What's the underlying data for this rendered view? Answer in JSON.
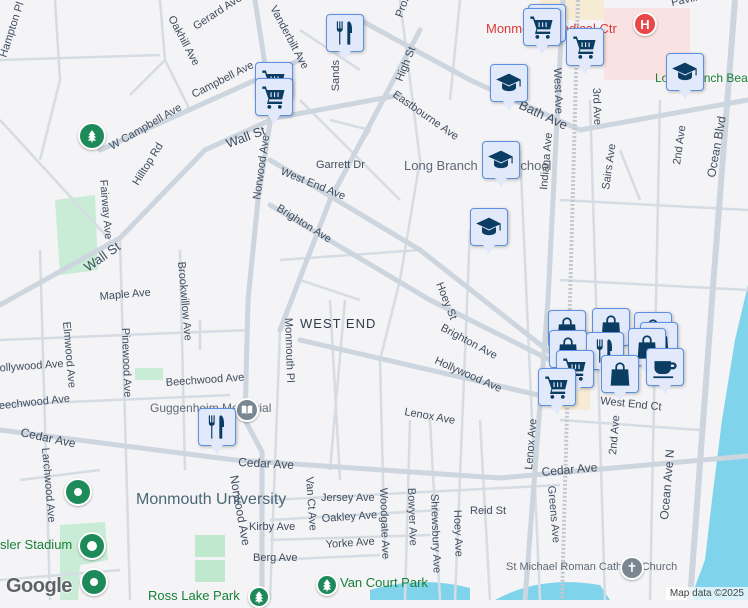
{
  "area_label": "WEST END",
  "streets": [
    "Gerard Ave",
    "Oakhill Ave",
    "Vanderbilt Ave",
    "Campbell Ave",
    "W Campbell Ave",
    "Hilltop Rd",
    "Wall St",
    "Wall St",
    "Sands",
    "High St",
    "Prospect",
    "Eastbourne Ave",
    "Bath Ave",
    "Garrett Dr",
    "West End Ave",
    "Brighton Ave",
    "Norwood Ave",
    "Fairway Ave",
    "Maple Ave",
    "Brookwillow Ave",
    "Elmwood Ave",
    "Pinewood Ave",
    "Monmouth Pl",
    "Hollywood Ave",
    "Beechwood Ave",
    "Beechwood Ave",
    "Hoey St",
    "Brighton Ave",
    "Hollywood Ave",
    "Lenox Ave",
    "Cedar Ave",
    "Cedar Ave",
    "Cedar Ave",
    "Larchwood Ave",
    "Norwood Ave",
    "Van Ct Ave",
    "Jersey Ave",
    "Oakley Ave",
    "Kirby Ave",
    "Yorke Ave",
    "Berg Ave",
    "Woodgate Ave",
    "Bowyer Ave",
    "Shrewsbury Ave",
    "Hoey Ave",
    "Reid St",
    "Lenox Ave",
    "Greens Ave",
    "West Ave",
    "Indiana Ave",
    "Sairs Ave",
    "3rd Ave",
    "2nd Ave",
    "2nd Ave",
    "Ocean Blvd",
    "Ocean Ave N",
    "West End Ct",
    "Hampton Pl",
    "Pavilion"
  ],
  "pois": {
    "hospital": "Monmouth Medical Ctr",
    "school": "Long Branch High School",
    "volleyball": "Long Branch Beach Volleyball",
    "memorial": "Guggenheim Memorial",
    "university": "Monmouth University",
    "stadium": "sler Stadium",
    "van_court_park": "Van Court Park",
    "ross_lake_park": "Ross Lake Park",
    "church": "St Michael Roman Catholic Church"
  },
  "footer": {
    "logo": "Google",
    "attribution": "Map data ©2025"
  },
  "colors": {
    "marker_fill": "#e1e9fb",
    "marker_border": "#5d8fe0",
    "icon": "#0b3c62",
    "park_green": "#1e8a5a",
    "hospital_red": "#d93b3b",
    "water": "#7fd3ea"
  }
}
